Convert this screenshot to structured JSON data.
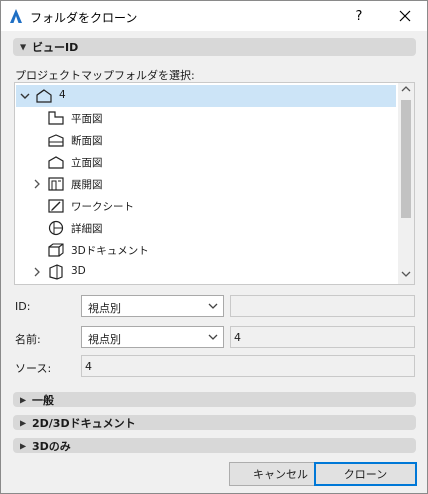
{
  "window": {
    "title": "フォルダをクローン",
    "help": "?",
    "close": "✕"
  },
  "view_id_section": {
    "label": "ビューID",
    "expanded": true
  },
  "tree": {
    "prompt": "プロジェクトマップフォルダを選択:",
    "items": [
      {
        "label": "4",
        "icon": "house-icon",
        "expandable": true,
        "expanded": true,
        "selected": true,
        "depth": 0
      },
      {
        "label": "平面図",
        "icon": "floor-plan-icon",
        "expandable": false,
        "depth": 1
      },
      {
        "label": "断面図",
        "icon": "section-icon",
        "expandable": false,
        "depth": 1
      },
      {
        "label": "立面図",
        "icon": "elevation-icon",
        "expandable": false,
        "depth": 1
      },
      {
        "label": "展開図",
        "icon": "interior-elevation-icon",
        "expandable": true,
        "expanded": false,
        "depth": 1
      },
      {
        "label": "ワークシート",
        "icon": "worksheet-icon",
        "expandable": false,
        "depth": 1
      },
      {
        "label": "詳細図",
        "icon": "detail-icon",
        "expandable": false,
        "depth": 1
      },
      {
        "label": "3Dドキュメント",
        "icon": "3d-document-icon",
        "expandable": false,
        "depth": 1
      },
      {
        "label": "3D",
        "icon": "3d-icon",
        "expandable": true,
        "expanded": false,
        "depth": 1
      }
    ]
  },
  "fields": {
    "id": {
      "label": "ID:",
      "select": "視点別",
      "value": ""
    },
    "name": {
      "label": "名前:",
      "select": "視点別",
      "value": "4"
    },
    "source": {
      "label": "ソース:",
      "value": "4"
    }
  },
  "sections": [
    {
      "label": "一般"
    },
    {
      "label": "2D/3Dドキュメント"
    },
    {
      "label": "3Dのみ"
    }
  ],
  "buttons": {
    "cancel": "キャンセル",
    "clone": "クローン"
  },
  "colors": {
    "selection": "#cce4f7",
    "accent": "#0078d7",
    "section_bar": "#d8d8d8"
  }
}
